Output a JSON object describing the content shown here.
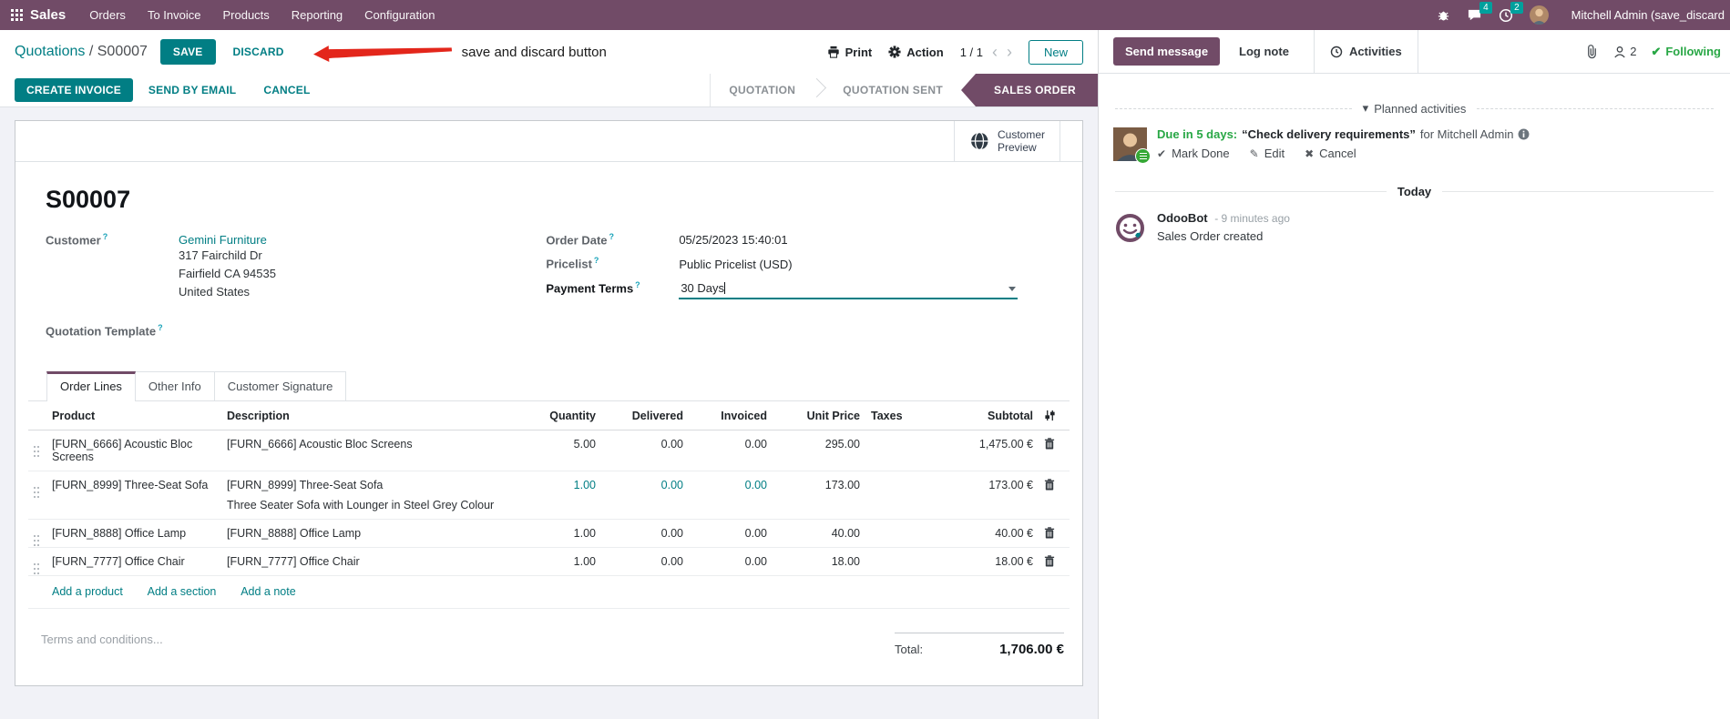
{
  "nav": {
    "app_name": "Sales",
    "menus": [
      "Orders",
      "To Invoice",
      "Products",
      "Reporting",
      "Configuration"
    ],
    "messages_badge": "4",
    "activities_badge": "2",
    "user_name": "Mitchell Admin (save_discard"
  },
  "control_panel": {
    "breadcrumb_parent": "Quotations",
    "breadcrumb_sep": "/",
    "breadcrumb_current": "S00007",
    "save": "SAVE",
    "discard": "DISCARD",
    "annotation": "save and discard button",
    "print": "Print",
    "action": "Action",
    "pager": "1 / 1",
    "new": "New"
  },
  "status_buttons": {
    "create_invoice": "CREATE INVOICE",
    "send_by_email": "SEND BY EMAIL",
    "cancel": "CANCEL",
    "stages": [
      "QUOTATION",
      "QUOTATION SENT",
      "SALES ORDER"
    ],
    "active_stage": "SALES ORDER"
  },
  "sheet": {
    "customer_preview_line1": "Customer",
    "customer_preview_line2": "Preview",
    "title": "S00007",
    "help_mark": "?",
    "customer": {
      "label": "Customer",
      "name": "Gemini Furniture",
      "address": [
        "317 Fairchild Dr",
        "Fairfield CA 94535",
        "United States"
      ]
    },
    "quotation_template_label": "Quotation Template",
    "order_date": {
      "label": "Order Date",
      "value": "05/25/2023 15:40:01"
    },
    "pricelist": {
      "label": "Pricelist",
      "value": "Public Pricelist (USD)"
    },
    "payment_terms": {
      "label": "Payment Terms",
      "value": "30 Days"
    },
    "tabs": [
      "Order Lines",
      "Other Info",
      "Customer Signature"
    ],
    "active_tab": "Order Lines",
    "table": {
      "columns": [
        "Product",
        "Description",
        "Quantity",
        "Delivered",
        "Invoiced",
        "Unit Price",
        "Taxes",
        "Subtotal"
      ],
      "rows": [
        {
          "product": "[FURN_6666] Acoustic Bloc Screens",
          "description": "[FURN_6666] Acoustic Bloc Screens",
          "description2": "",
          "quantity": "5.00",
          "delivered": "0.00",
          "invoiced": "0.00",
          "unit_price": "295.00",
          "taxes": "",
          "subtotal": "1,475.00 €"
        },
        {
          "product": "[FURN_8999] Three-Seat Sofa",
          "description": "[FURN_8999] Three-Seat Sofa",
          "description2": "Three Seater Sofa with Lounger in Steel Grey Colour",
          "quantity": "1.00",
          "delivered": "0.00",
          "invoiced": "0.00",
          "unit_price": "173.00",
          "taxes": "",
          "subtotal": "173.00 €"
        },
        {
          "product": "[FURN_8888] Office Lamp",
          "description": "[FURN_8888] Office Lamp",
          "description2": "",
          "quantity": "1.00",
          "delivered": "0.00",
          "invoiced": "0.00",
          "unit_price": "40.00",
          "taxes": "",
          "subtotal": "40.00 €"
        },
        {
          "product": "[FURN_7777] Office Chair",
          "description": "[FURN_7777] Office Chair",
          "description2": "",
          "quantity": "1.00",
          "delivered": "0.00",
          "invoiced": "0.00",
          "unit_price": "18.00",
          "taxes": "",
          "subtotal": "18.00 €"
        }
      ],
      "add_links": [
        "Add a product",
        "Add a section",
        "Add a note"
      ]
    },
    "terms_placeholder": "Terms and conditions...",
    "total_label": "Total:",
    "total_value": "1,706.00 €"
  },
  "chatter": {
    "send_message": "Send message",
    "log_note": "Log note",
    "activities": "Activities",
    "followers_count": "2",
    "following": "Following",
    "planned_title": "Planned activities",
    "activity": {
      "due": "Due in 5 days:",
      "summary": "“Check delivery requirements”",
      "assignee": "for Mitchell Admin",
      "mark_done": "Mark Done",
      "edit": "Edit",
      "cancel": "Cancel"
    },
    "today": "Today",
    "message": {
      "author": "OdooBot",
      "time": "- 9 minutes ago",
      "body": "Sales Order created"
    }
  },
  "icons": {
    "check": "✔",
    "pencil": "✎",
    "times": "✖",
    "caret_down": "▾",
    "chevron_left": "‹",
    "chevron_right": "›"
  },
  "colors": {
    "primary_purple": "#714B67",
    "accent_teal": "#017E84",
    "badge_teal": "#00A09D",
    "success_green": "#28a745",
    "annotation_red": "#e3261b",
    "page_bg": "#f1f2f7"
  }
}
